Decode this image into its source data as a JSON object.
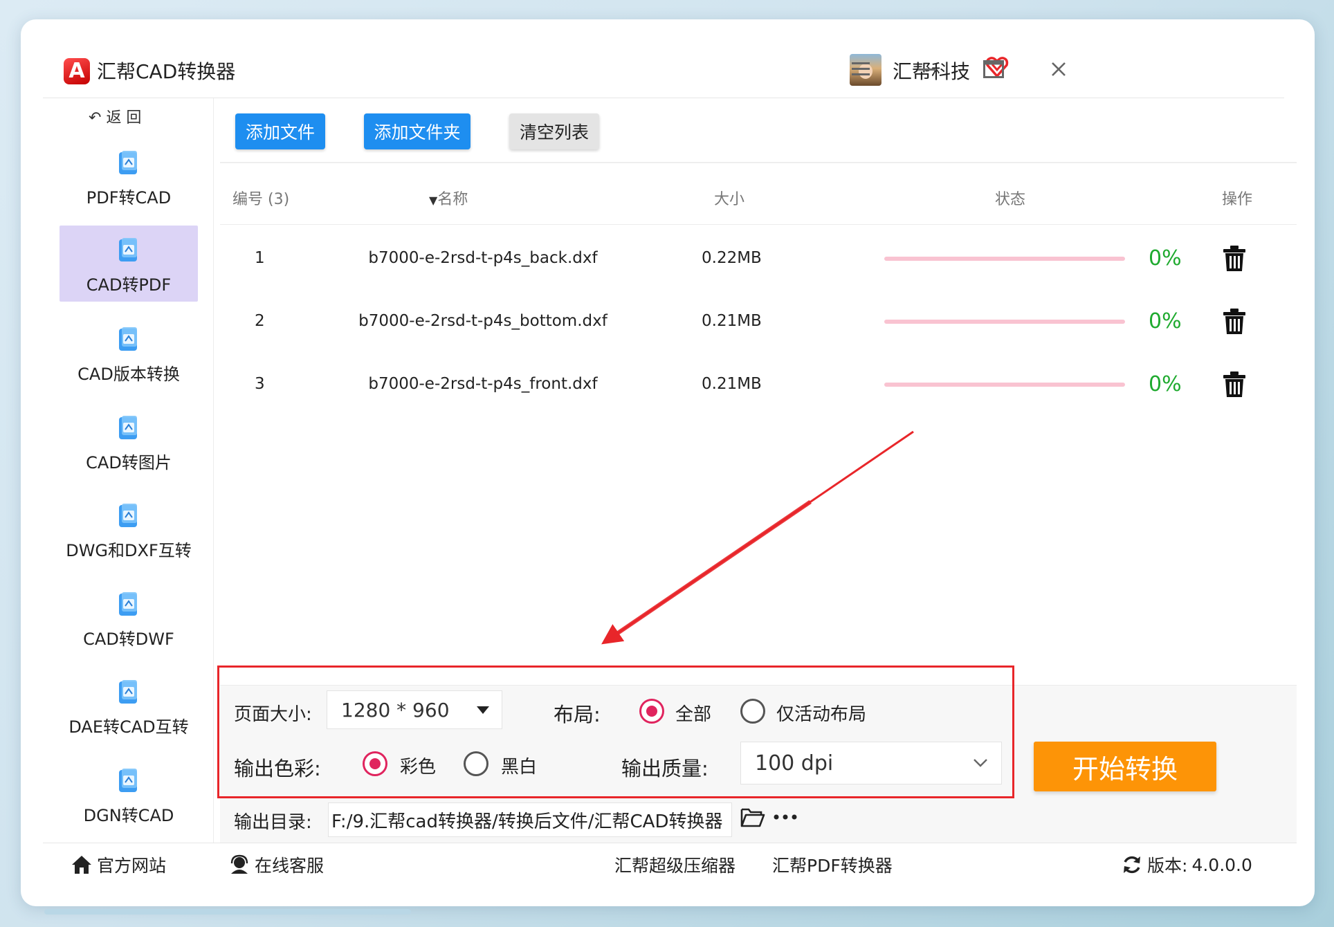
{
  "app": {
    "title": "汇帮CAD转换器",
    "logo_letter": "A",
    "username": "汇帮科技"
  },
  "sidebar": {
    "back_label": "返 回",
    "items": [
      {
        "label": "PDF转CAD"
      },
      {
        "label": "CAD转PDF",
        "active": true
      },
      {
        "label": "CAD版本转换"
      },
      {
        "label": "CAD转图片"
      },
      {
        "label": "DWG和DXF互转"
      },
      {
        "label": "CAD转DWF"
      },
      {
        "label": "DAE转CAD互转"
      },
      {
        "label": "DGN转CAD"
      }
    ]
  },
  "toolbar": {
    "add_file": "添加文件",
    "add_folder": "添加文件夹",
    "clear_list": "清空列表"
  },
  "table": {
    "headers": {
      "index": "编号 (3)",
      "name": "名称",
      "size": "大小",
      "status": "状态",
      "action": "操作"
    },
    "rows": [
      {
        "index": "1",
        "name": "b7000-e-2rsd-t-p4s_back.dxf",
        "size": "0.22MB",
        "progress": 0,
        "percent": "0%"
      },
      {
        "index": "2",
        "name": "b7000-e-2rsd-t-p4s_bottom.dxf",
        "size": "0.21MB",
        "progress": 0,
        "percent": "0%"
      },
      {
        "index": "3",
        "name": "b7000-e-2rsd-t-p4s_front.dxf",
        "size": "0.21MB",
        "progress": 0,
        "percent": "0%"
      }
    ]
  },
  "settings": {
    "page_size_label": "页面大小:",
    "page_size_value": "1280 * 960",
    "layout_label": "布局:",
    "layout_all": "全部",
    "layout_active_only": "仅活动布局",
    "color_label": "输出色彩:",
    "color_color": "彩色",
    "color_bw": "黑白",
    "quality_label": "输出质量:",
    "quality_value": "100 dpi",
    "output_dir_label": "输出目录:",
    "output_dir_value": "F:/9.汇帮cad转换器/转换后文件/汇帮CAD转换器",
    "start_button": "开始转换"
  },
  "footer": {
    "website": "官方网站",
    "support": "在线客服",
    "compressor": "汇帮超级压缩器",
    "pdf_converter": "汇帮PDF转换器",
    "version_label": "版本:",
    "version_value": "4.0.0.0"
  },
  "colors": {
    "accent_blue": "#1e8ef0",
    "start_orange": "#fd9407",
    "progress_green": "#1faa2f",
    "highlight_red": "#e8262a",
    "active_sidebar": "#dcd4f6"
  },
  "icons": [
    "vip-heart-icon",
    "menu-icon",
    "minimize-icon",
    "maximize-icon",
    "close-icon",
    "back-icon",
    "file-convert-icon",
    "trash-icon",
    "folder-open-icon",
    "more-icon",
    "home-icon",
    "headset-icon",
    "refresh-icon",
    "dropdown-caret-icon",
    "chevron-down-icon",
    "sort-caret-icon"
  ]
}
